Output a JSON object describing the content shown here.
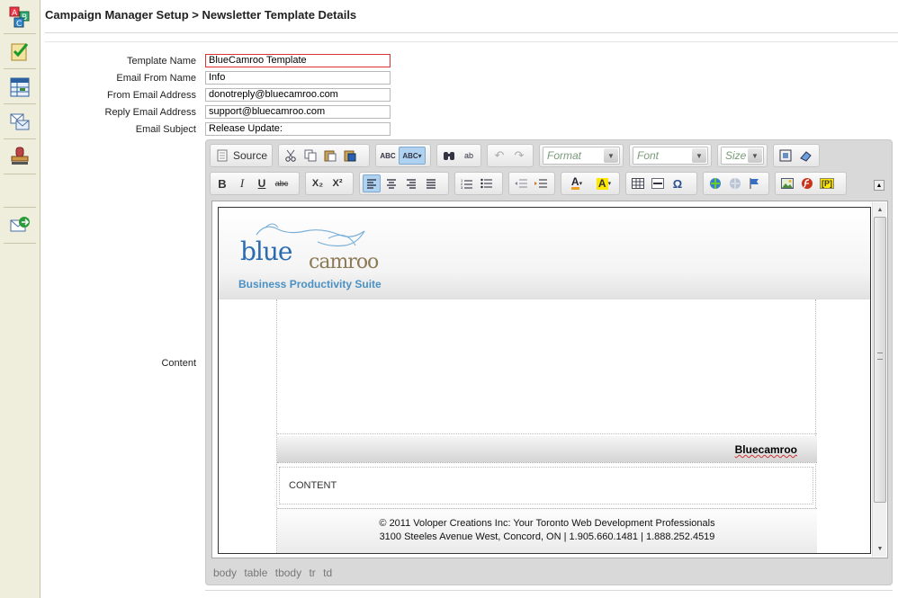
{
  "breadcrumb": "Campaign Manager Setup > Newsletter Template Details",
  "sidebar": {
    "icons": [
      "abc-spelling-icon",
      "checklist-icon",
      "spreadsheet-icon",
      "mail-merge-icon",
      "stamp-icon",
      "email-send-icon"
    ]
  },
  "form": {
    "template_name_label": "Template Name",
    "template_name_value": "BlueCamroo Template",
    "email_from_name_label": "Email From Name",
    "email_from_name_value": "Info",
    "from_email_label": "From Email Address",
    "from_email_value": "donotreply@bluecamroo.com",
    "reply_email_label": "Reply Email Address",
    "reply_email_value": "support@bluecamroo.com",
    "subject_label": "Email Subject",
    "subject_value": "Release Update:",
    "content_label": "Content"
  },
  "toolbar": {
    "source_label": "Source",
    "format_label": "Format",
    "font_label": "Font",
    "size_label": "Size",
    "bold": "B",
    "italic": "I",
    "underline": "U",
    "strike": "abc",
    "subscript": "X₂",
    "superscript": "X²",
    "placeholder": "[P]"
  },
  "template": {
    "logo_blue": "blue",
    "logo_camroo": "camroo",
    "logo_tagline": "Business Productivity Suite",
    "brand": "Bluecamroo",
    "content_placeholder": "CONTENT",
    "footer_line1": "© 2011 Voloper Creations Inc: Your Toronto Web Development Professionals",
    "footer_line2": "3100 Steeles Avenue West, Concord, ON | 1.905.660.1481 | 1.888.252.4519"
  },
  "element_path": [
    "body",
    "table",
    "tbody",
    "tr",
    "td"
  ]
}
